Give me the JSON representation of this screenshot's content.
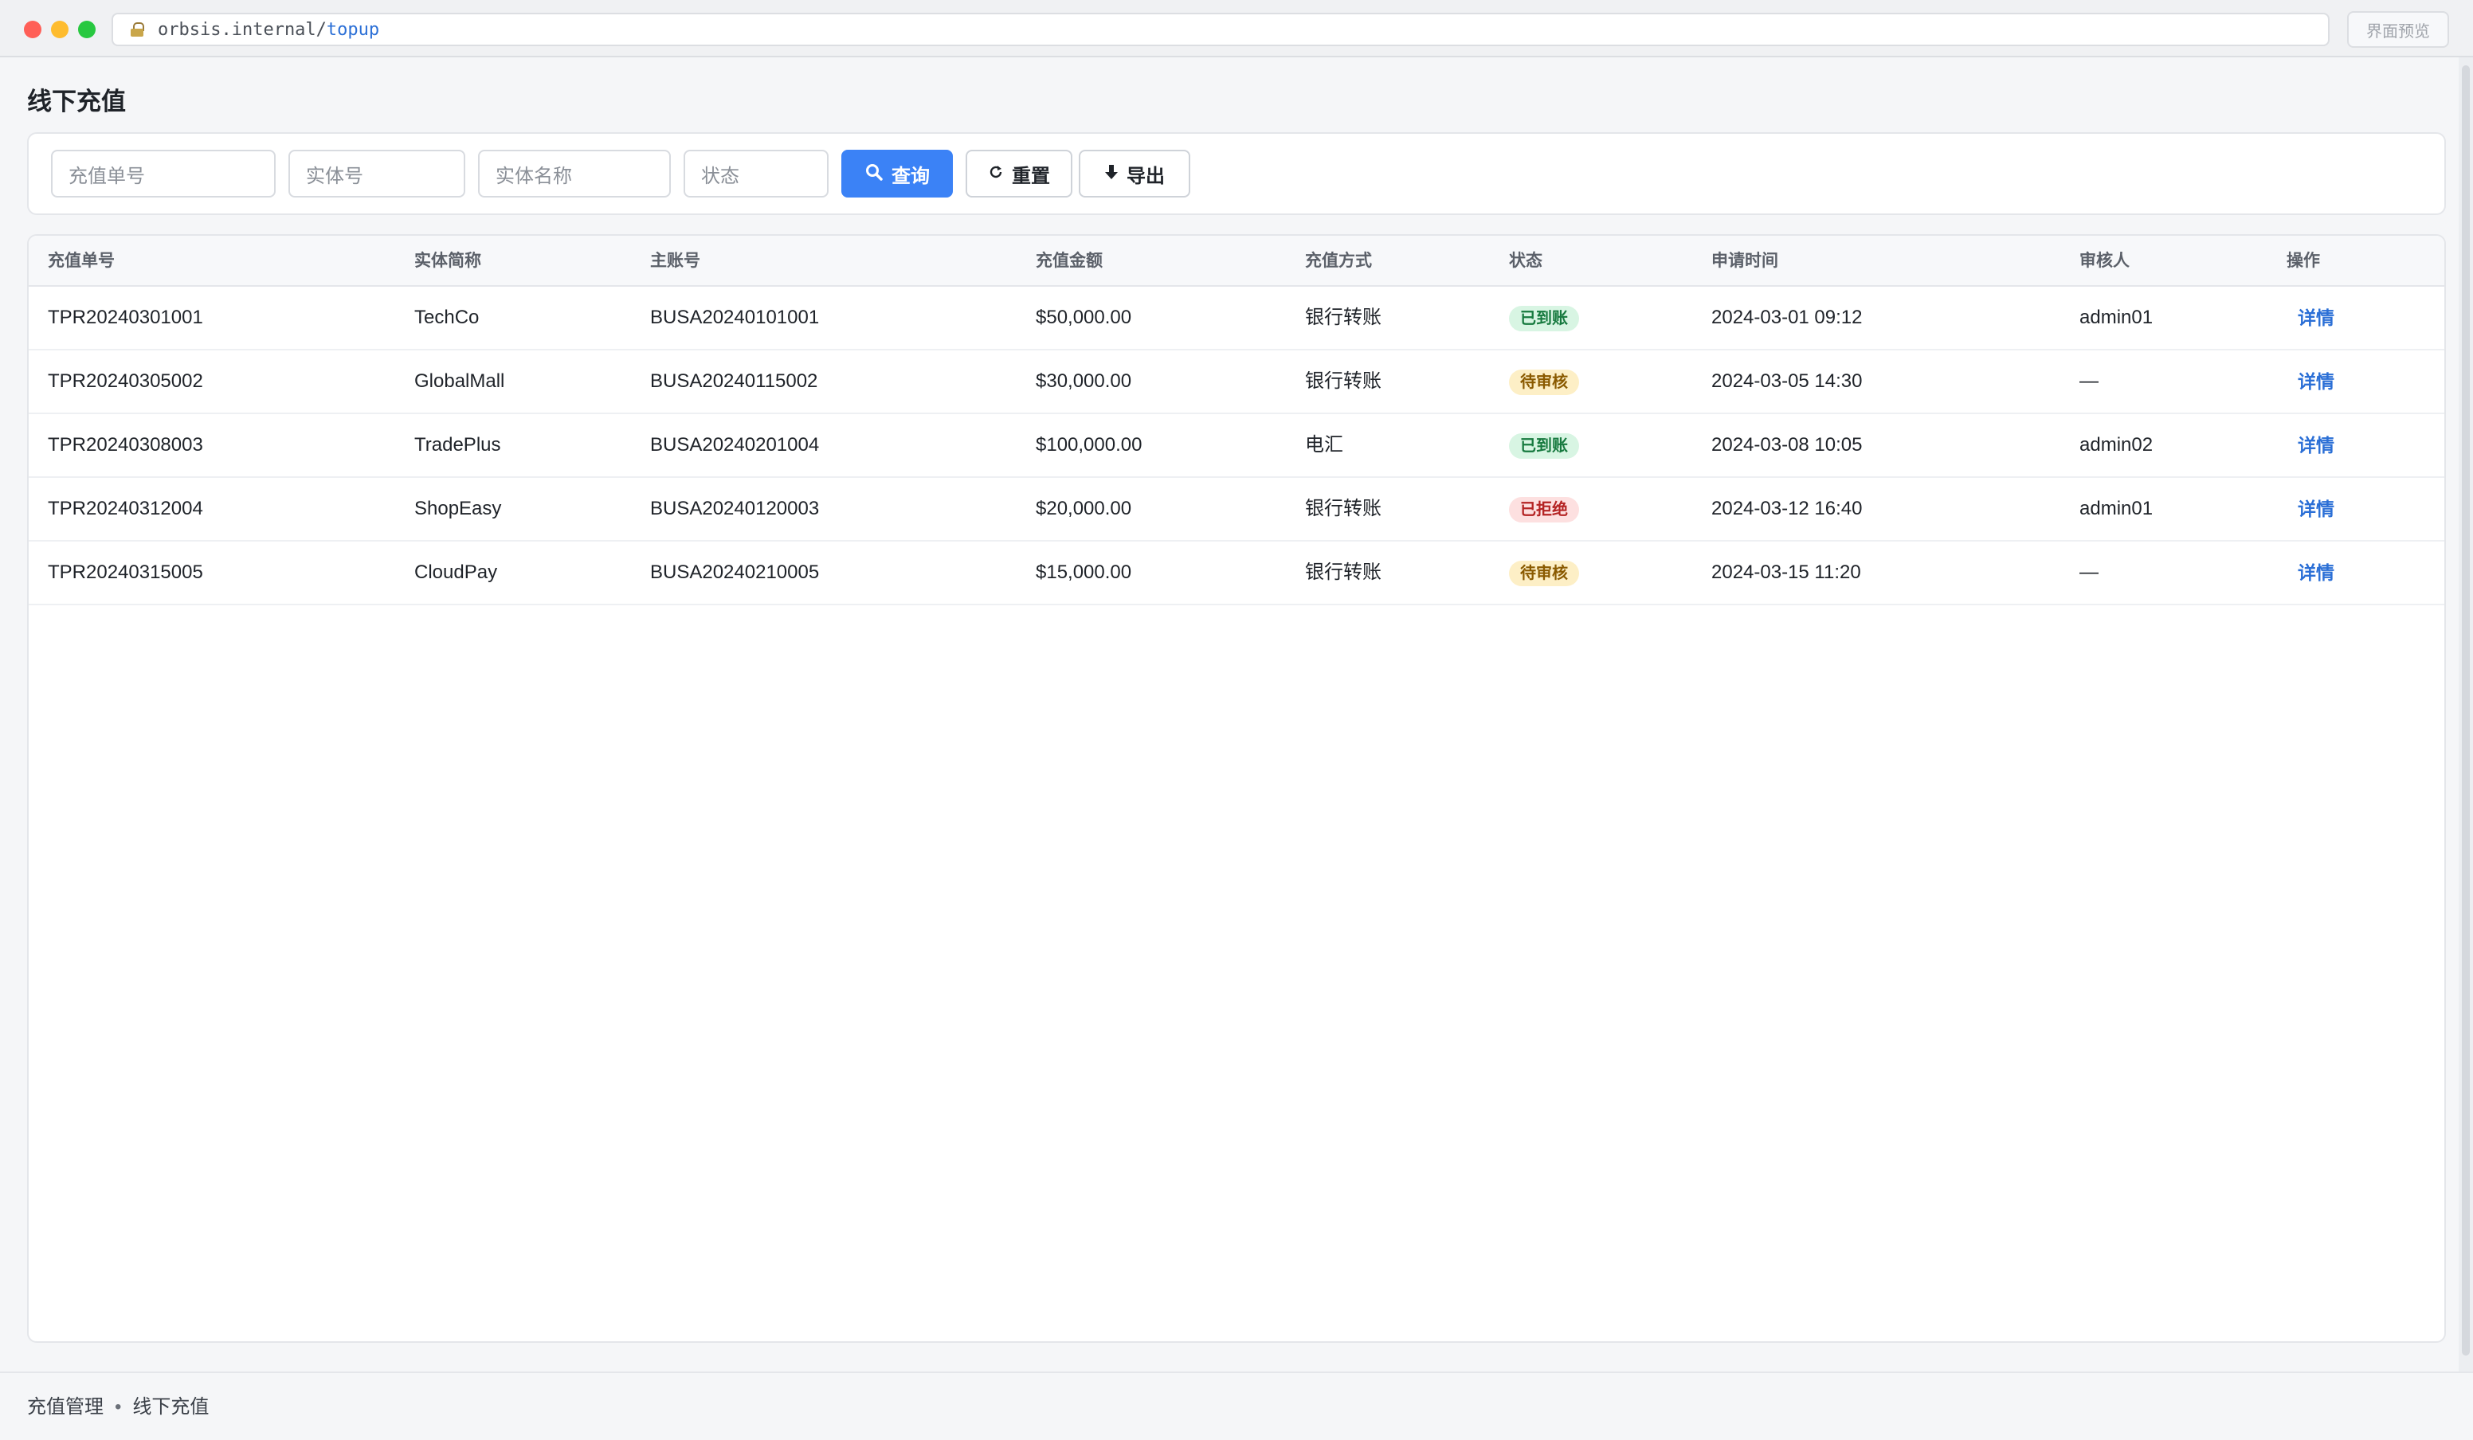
{
  "browser": {
    "url_host": "orbsis.internal/",
    "url_path": "topup",
    "preview_label": "界面预览"
  },
  "page": {
    "title": "线下充值"
  },
  "filters": {
    "order_no_placeholder": "充值单号",
    "entity_no_placeholder": "实体号",
    "entity_name_placeholder": "实体名称",
    "status_placeholder": "状态",
    "search_label": "查询",
    "reset_label": "重置",
    "export_label": "导出"
  },
  "table": {
    "columns": [
      "充值单号",
      "实体简称",
      "主账号",
      "充值金额",
      "充值方式",
      "状态",
      "申请时间",
      "审核人",
      "操作"
    ],
    "rows": [
      {
        "order_no": "TPR20240301001",
        "entity": "TechCo",
        "account": "BUSA20240101001",
        "amount": "$50,000.00",
        "method": "银行转账",
        "status": "已到账",
        "status_type": "ok",
        "time": "2024-03-01 09:12",
        "reviewer": "admin01",
        "action": "详情"
      },
      {
        "order_no": "TPR20240305002",
        "entity": "GlobalMall",
        "account": "BUSA20240115002",
        "amount": "$30,000.00",
        "method": "银行转账",
        "status": "待审核",
        "status_type": "pending",
        "time": "2024-03-05 14:30",
        "reviewer": "—",
        "action": "详情"
      },
      {
        "order_no": "TPR20240308003",
        "entity": "TradePlus",
        "account": "BUSA20240201004",
        "amount": "$100,000.00",
        "method": "电汇",
        "status": "已到账",
        "status_type": "ok",
        "time": "2024-03-08 10:05",
        "reviewer": "admin02",
        "action": "详情"
      },
      {
        "order_no": "TPR20240312004",
        "entity": "ShopEasy",
        "account": "BUSA20240120003",
        "amount": "$20,000.00",
        "method": "银行转账",
        "status": "已拒绝",
        "status_type": "rejected",
        "time": "2024-03-12 16:40",
        "reviewer": "admin01",
        "action": "详情"
      },
      {
        "order_no": "TPR20240315005",
        "entity": "CloudPay",
        "account": "BUSA20240210005",
        "amount": "$15,000.00",
        "method": "银行转账",
        "status": "待审核",
        "status_type": "pending",
        "time": "2024-03-15 11:20",
        "reviewer": "—",
        "action": "详情"
      }
    ]
  },
  "breadcrumb": {
    "parent": "充值管理",
    "separator": "•",
    "current": "线下充值"
  },
  "colors": {
    "primary": "#3b82f6",
    "link": "#2b6fd6",
    "status_ok_bg": "#d8f5e3",
    "status_pending_bg": "#fdefc6",
    "status_rejected_bg": "#fde0e0"
  },
  "icons": {
    "search": "magnifier-icon",
    "reset": "refresh-icon",
    "export": "download-icon",
    "lock": "lock-icon"
  }
}
